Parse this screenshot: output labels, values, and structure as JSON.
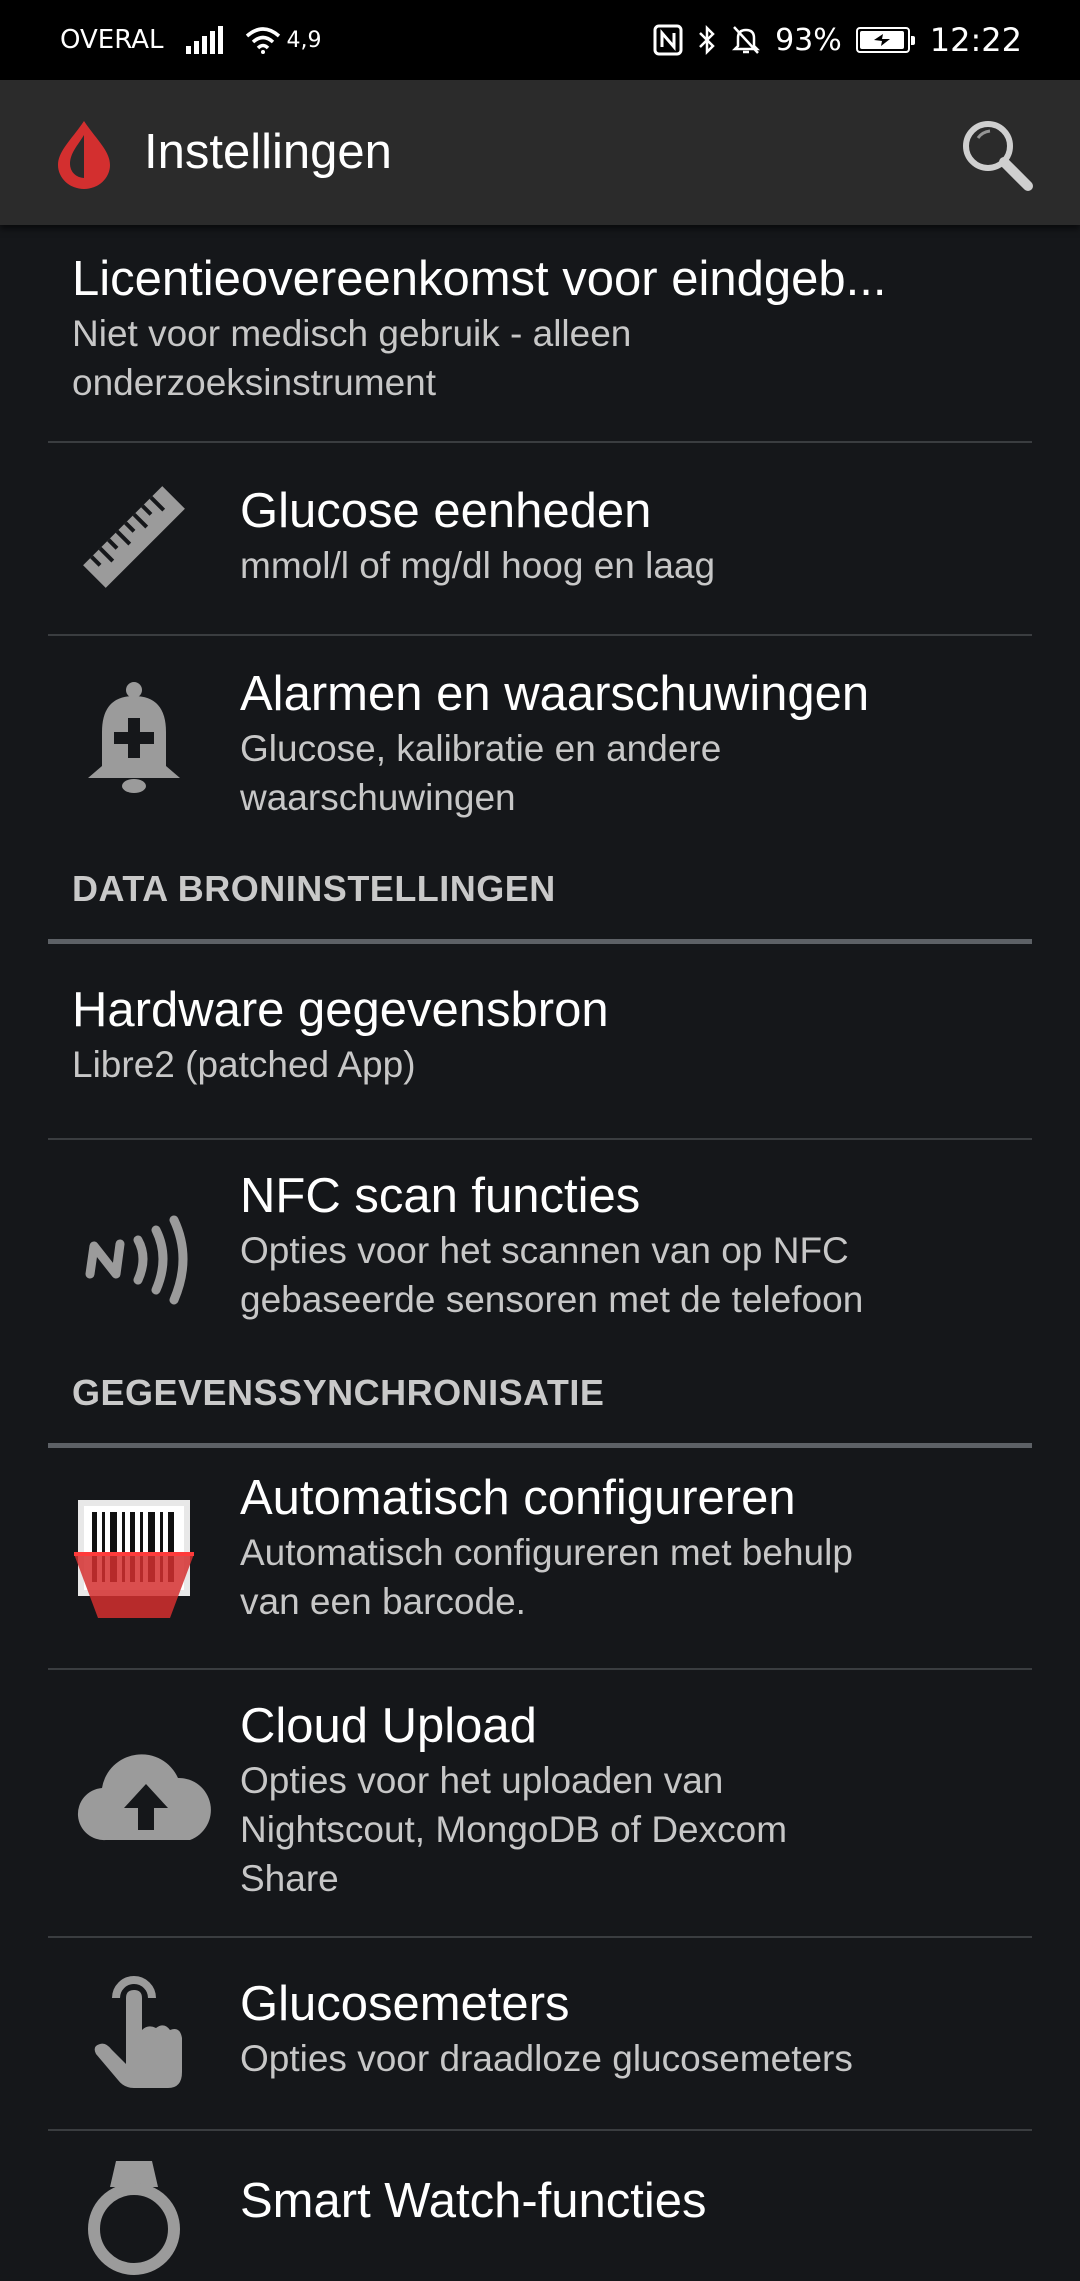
{
  "status_bar": {
    "carrier": "OVERAL",
    "network_speed": "4,9",
    "battery": "93%",
    "time": "12:22"
  },
  "app_bar": {
    "title": "Instellingen",
    "logo_icon": "blood-drop-icon",
    "search_icon": "search-icon"
  },
  "items": [
    {
      "title": "Licentieovereenkomst voor eindgeb...",
      "summary": [
        "Niet voor medisch gebruik - alleen",
        "onderzoeksinstrument"
      ],
      "icon": null
    },
    {
      "title": "Glucose eenheden",
      "summary": [
        "mmol/l of mg/dl hoog en laag"
      ],
      "icon": "ruler-icon"
    },
    {
      "title": "Alarmen en waarschuwingen",
      "summary": [
        "Glucose, kalibratie en andere",
        "waarschuwingen"
      ],
      "icon": "alarm-bell-icon"
    }
  ],
  "categories": {
    "data_sources": "DATA BRONINSTELLINGEN",
    "data_sync": "GEGEVENSSYNCHRONISATIE"
  },
  "items_data_sources": [
    {
      "title": "Hardware gegevensbron",
      "summary": [
        "Libre2 (patched App)"
      ],
      "icon": null
    },
    {
      "title": "NFC scan functies",
      "summary": [
        "Opties voor het scannen van op NFC",
        "gebaseerde sensoren met de telefoon"
      ],
      "icon": "nfc-icon"
    }
  ],
  "items_sync": [
    {
      "title": "Automatisch configureren",
      "summary": [
        "Automatisch configureren met behulp",
        "van een barcode."
      ],
      "icon": "barcode-scan-icon"
    },
    {
      "title": "Cloud Upload",
      "summary": [
        "Opties voor het uploaden van",
        "Nightscout, MongoDB of Dexcom",
        "Share"
      ],
      "icon": "cloud-upload-icon"
    },
    {
      "title": "Glucosemeters",
      "summary": [
        "Opties voor draadloze glucosemeters"
      ],
      "icon": "touch-hand-icon"
    },
    {
      "title": "Smart Watch-functies",
      "summary": [],
      "icon": "smartwatch-icon"
    }
  ],
  "colors": {
    "background": "#15171a",
    "app_bar": "#2b2b2b",
    "accent_red": "#d32f2f",
    "icon_gray": "#9b9b9b",
    "summary_text": "#c7c7c7",
    "category_text": "#c9c9c9"
  }
}
